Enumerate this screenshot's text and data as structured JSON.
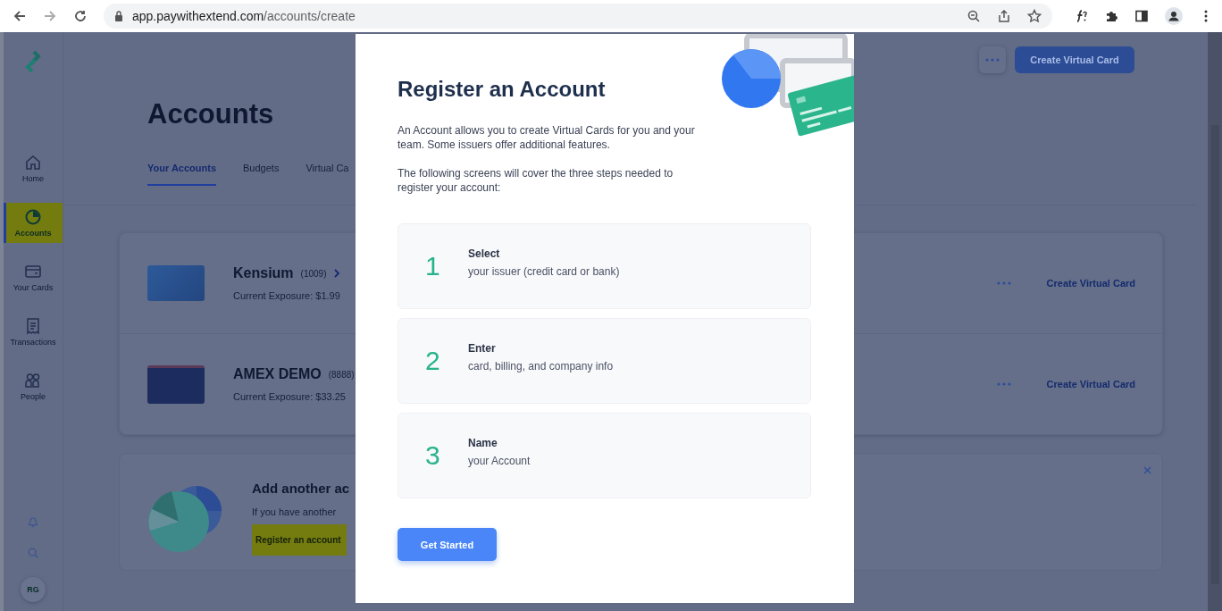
{
  "browser": {
    "url_host": "app.paywithextend.com",
    "url_path": "/accounts/create"
  },
  "sidebar": {
    "items": [
      {
        "label": "Home",
        "selected": false,
        "highlighted": false
      },
      {
        "label": "Accounts",
        "selected": true,
        "highlighted": true
      },
      {
        "label": "Your Cards",
        "selected": false,
        "highlighted": false
      },
      {
        "label": "Transactions",
        "selected": false,
        "highlighted": false
      },
      {
        "label": "People",
        "selected": false,
        "highlighted": false
      }
    ],
    "avatar": "RG"
  },
  "page": {
    "title": "Accounts",
    "tabs": [
      {
        "label": "Your Accounts",
        "selected": true
      },
      {
        "label": "Budgets",
        "selected": false
      },
      {
        "label": "Virtual Ca",
        "selected": false
      }
    ],
    "header_button": "Create Virtual Card",
    "accounts": [
      {
        "name": "Kensium",
        "number": "(1009)",
        "chevron": true,
        "exposure": "Current Exposure: $1.99",
        "action": "Create Virtual Card"
      },
      {
        "name": "AMEX DEMO",
        "number": "(8888)",
        "chevron": false,
        "exposure": "Current Exposure: $33.25",
        "action": "Create Virtual Card"
      }
    ],
    "promo": {
      "title": "Add another ac",
      "text": "If you have another",
      "link": "Register an account",
      "link_highlighted": true
    }
  },
  "modal": {
    "title": "Register an Account",
    "paragraphs": [
      "An Account allows you to create Virtual Cards for you and your team. Some issuers offer additional features.",
      "The following screens will cover the three steps needed to register your account:"
    ],
    "steps": [
      {
        "number": "1",
        "title": "Select",
        "text": "your issuer (credit card or bank)"
      },
      {
        "number": "2",
        "title": "Enter",
        "text": "card, billing, and company info"
      },
      {
        "number": "3",
        "title": "Name",
        "text": "your Account"
      }
    ],
    "button": "Get Started"
  }
}
